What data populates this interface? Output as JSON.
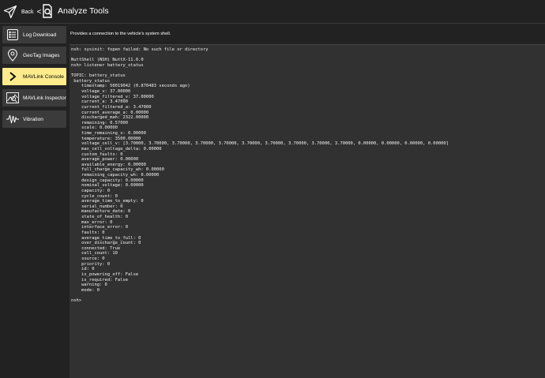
{
  "header": {
    "back_label": "Back",
    "chevron": "<",
    "title": "Analyze Tools",
    "back_icon": "paper-plane-icon",
    "tool_icon": "analyze-tool-icon"
  },
  "sidebar": {
    "items": [
      {
        "label": "Log Download",
        "icon": "list-icon",
        "active": false
      },
      {
        "label": "GeoTag Images",
        "icon": "map-pin-icon",
        "active": false
      },
      {
        "label": "MAVLink Console",
        "icon": "chevron-right-icon",
        "active": true
      },
      {
        "label": "MAVLink Inspector",
        "icon": "chart-icon",
        "active": false
      },
      {
        "label": "Vibration",
        "icon": "waveform-icon",
        "active": false
      }
    ]
  },
  "main": {
    "description": "Provides a connection to the vehicle's system shell.",
    "console_lines": [
      "nsh: sysinit: fopen failed: No such file or directory",
      "",
      "NuttShell (NSH) NuttX-11.0.0",
      "nsh> listener battery_status",
      "",
      "TOPIC: battery_status",
      " battery_status",
      "    timestamp: 50019042 (0.870483 seconds ago)",
      "    voltage_v: 37.00000",
      "    voltage_filtered_v: 37.00000",
      "    current_a: 3.47000",
      "    current_filtered_a: 3.47000",
      "    current_average_a: 0.00000",
      "    discharged_mah: 2322.00000",
      "    remaining: 0.57000",
      "    scale: 0.00000",
      "    time_remaining_s: 0.00000",
      "    temperature: 3500.00000",
      "    voltage_cell_v: [3.70000, 3.70000, 3.70000, 3.70000, 3.70000, 3.70000, 3.70000, 3.70000, 3.70000, 3.70000, 0.00000, 0.00000, 0.00000, 0.00000]",
      "    max_cell_voltage_delta: 0.00000",
      "    custom_faults: 0",
      "    average_power: 0.00000",
      "    available_energy: 0.00000",
      "    full_charge_capacity_wh: 0.00000",
      "    remaining_capacity_wh: 0.00000",
      "    design_capacity: 0.00000",
      "    nominal_voltage: 0.00000",
      "    capacity: 0",
      "    cycle_count: 0",
      "    average_time_to_empty: 0",
      "    serial_number: 0",
      "    manufacture_date: 0",
      "    state_of_health: 0",
      "    max_error: 0",
      "    interface_error: 0",
      "    faults: 0",
      "    average_time_to_full: 0",
      "    over_discharge_count: 0",
      "    connected: True",
      "    cell_count: 10",
      "    source: 0",
      "    priority: 0",
      "    id: 0",
      "    is_powering_off: False",
      "    is_required: False",
      "    warning: 0",
      "    mode: 0",
      "",
      "nsh>"
    ]
  },
  "colors": {
    "background": "#222222",
    "sidebar_item": "#3b3b3b",
    "active_item": "#fdeb8c",
    "console_bg": "#313131",
    "text": "#ffffff"
  }
}
